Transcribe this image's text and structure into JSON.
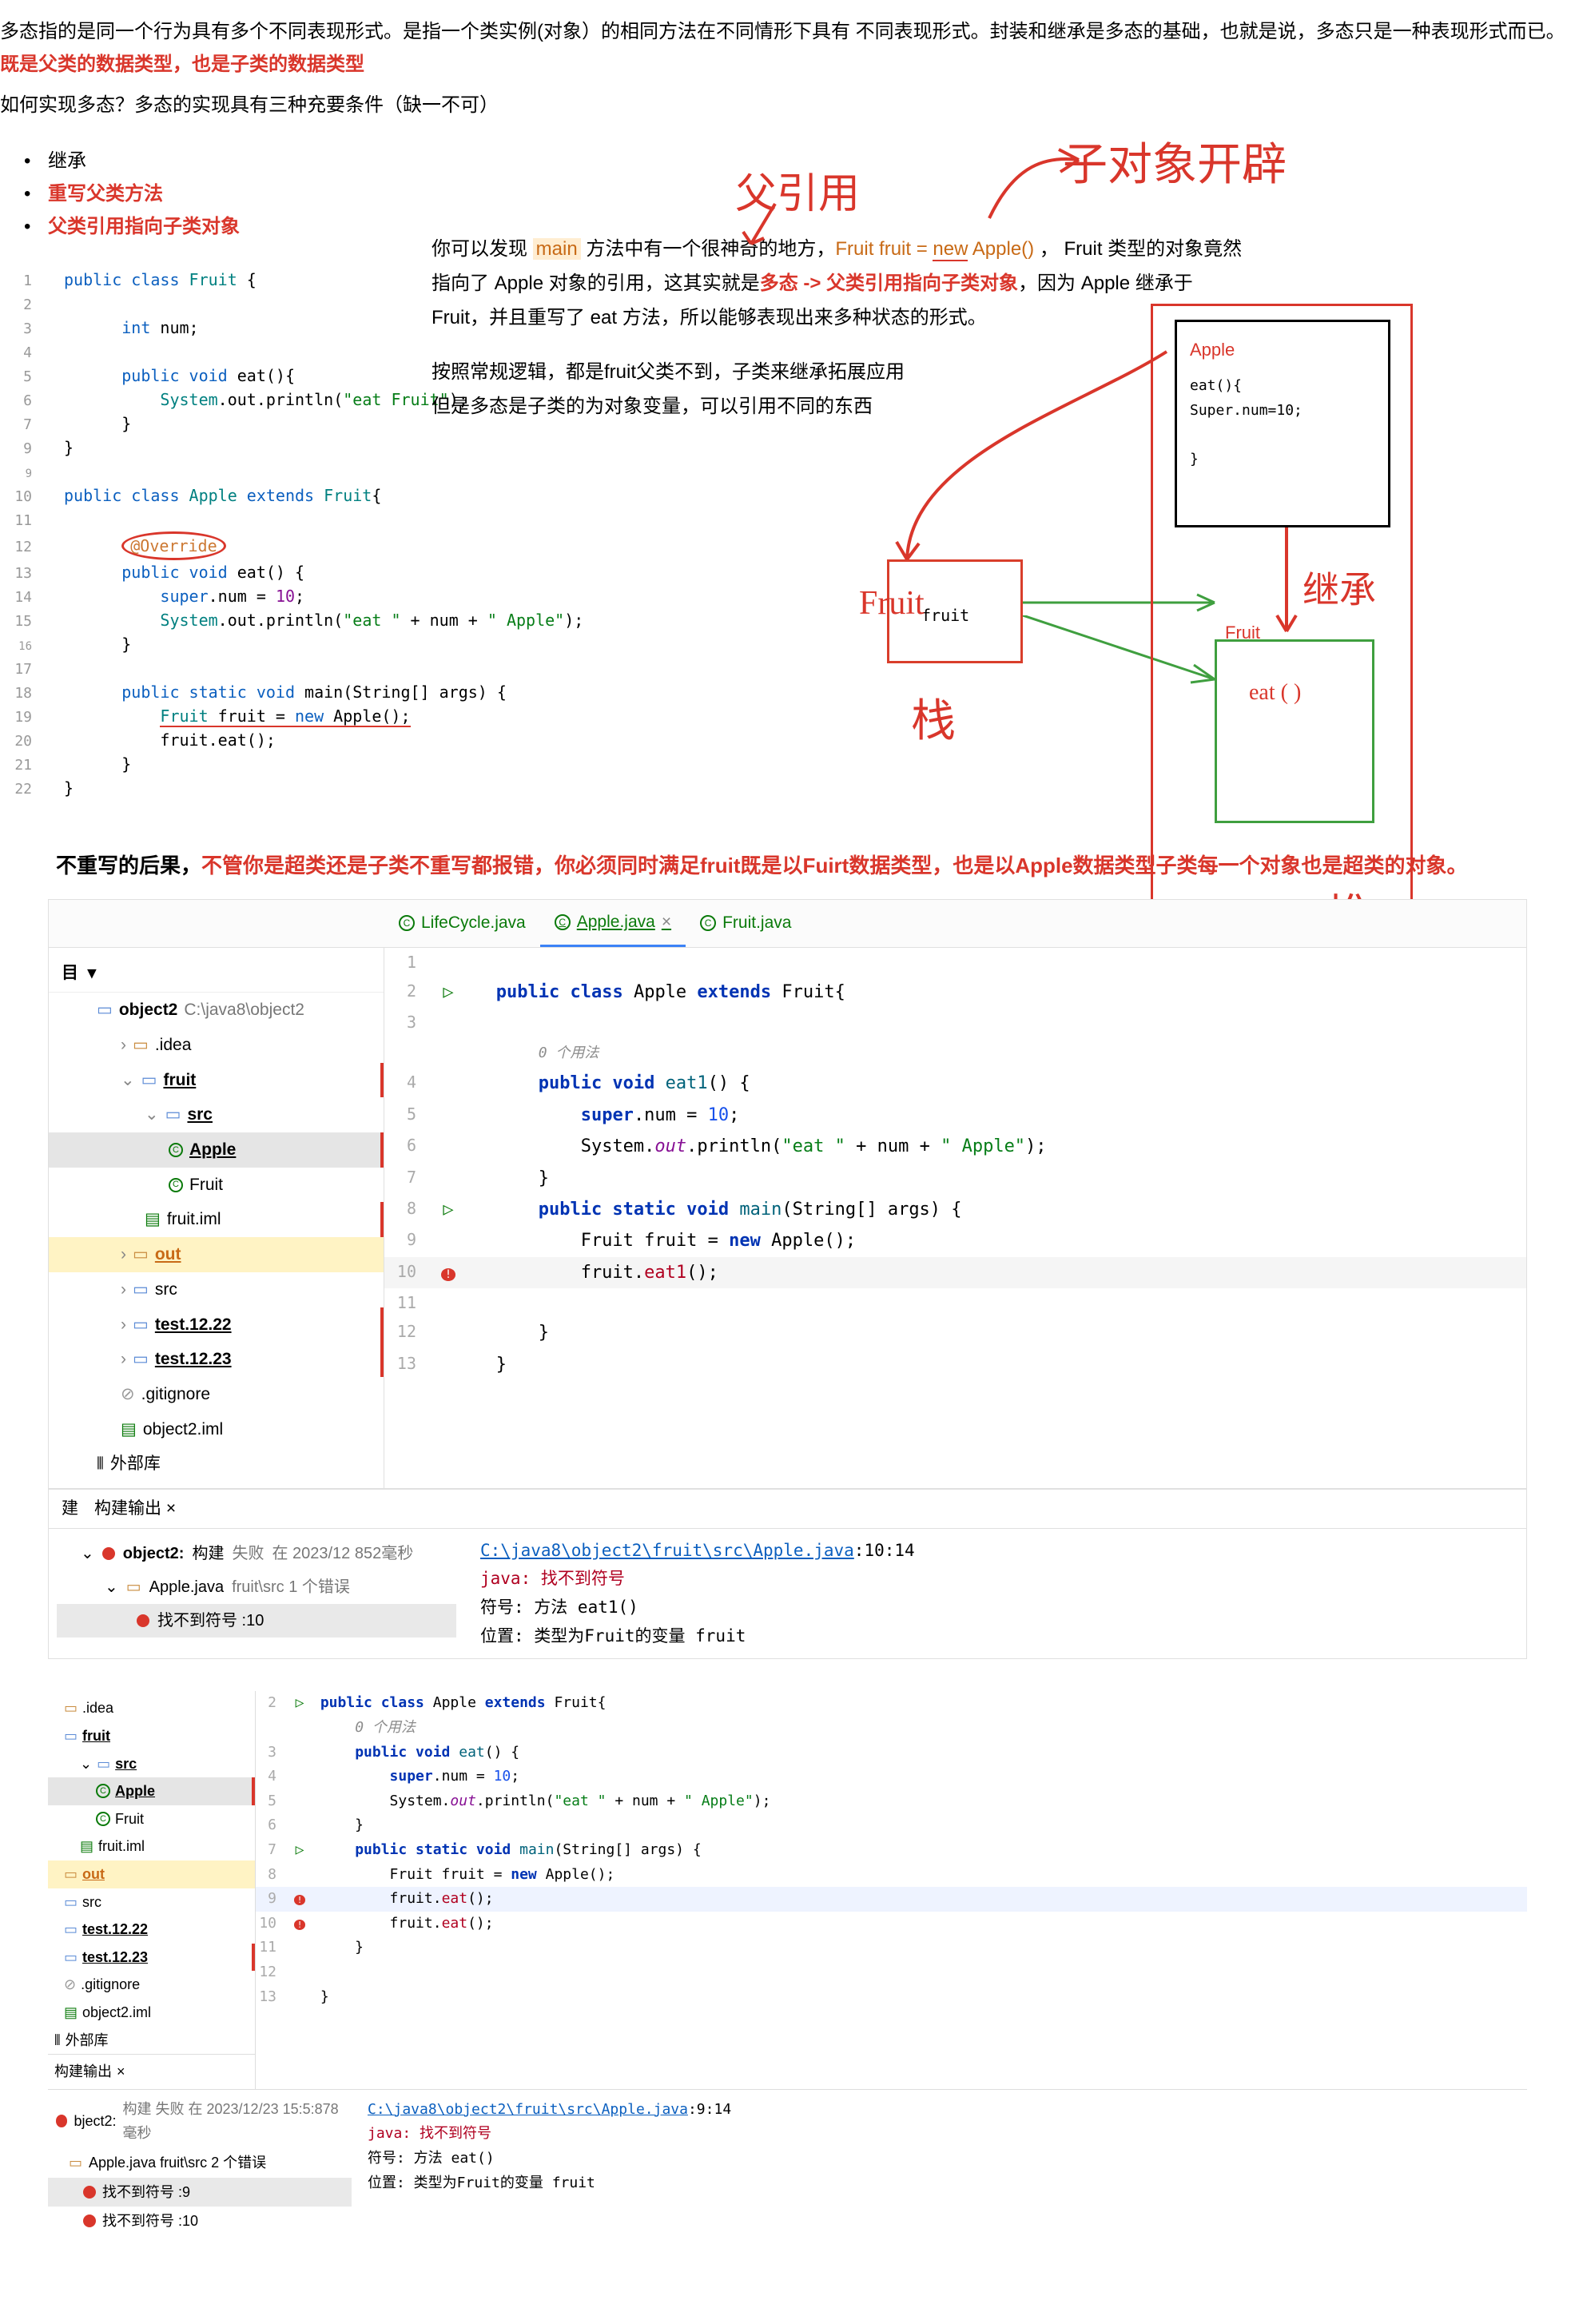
{
  "intro": {
    "line1": "多态指的是同一个行为具有多个不同表现形式。是指一个类实例(对象）的相同方法在不同情形下具有 不同表现形式。封装和继承是多态的基础，也就是说，多态只是一种表现形式而已。",
    "redSuffix": "既是父类的数据类型，也是子类的数据类型",
    "line2": "如何实现多态？多态的实现具有三种充要条件（缺一不可）",
    "b1": "继承",
    "b2": "重写父类方法",
    "b3": "父类引用指向子类对象"
  },
  "rightcol": {
    "l1a": "你可以发现 ",
    "l1b": "main",
    "l1c": " 方法中有一个很神奇的地方，",
    "l1d": "Fruit fruit = ",
    "l1e": "new",
    "l1f": " Apple()",
    "l1g": " ， Fruit 类型的对象竟然指向了 Apple 对象的引用，这其实就是",
    "l1h": "多态 -> 父类引用指向子类对象",
    "l1i": "，因为 Apple 继承于 Fruit，并且重写了 eat 方法，所以能够表现出来多种状态的形式。",
    "l2": "按照常规逻辑，都是fruit父类不到，子类来继承拓展应用",
    "l3": "但是多态是子类的为对象变量，可以引用不同的东西"
  },
  "code1": {
    "l1a": "public",
    "l1b": " class ",
    "l1c": "Fruit",
    "l1d": " {",
    "l3a": "int",
    "l3b": " num;",
    "l5a": "public",
    "l5b": " void ",
    "l5c": "eat",
    "l5d": "(){",
    "l6a": "System",
    "l6b": ".out.",
    "l6c": "println",
    "l6d": "(",
    "l6e": "\"eat Fruit\"",
    "l6f": ");",
    "l7": "}",
    "l9": "}",
    "l10a": "public",
    "l10b": " class ",
    "l10c": "Apple",
    "l10d": " extends ",
    "l10e": "Fruit",
    "l10f": "{",
    "l12": "@Override",
    "l13a": "public",
    "l13b": " void ",
    "l13c": "eat",
    "l13d": "() {",
    "l14a": "super",
    "l14b": ".num = ",
    "l14c": "10",
    "l14d": ";",
    "l15a": "System",
    "l15b": ".out.",
    "l15c": "println",
    "l15d": "(",
    "l15e": "\"eat \"",
    "l15f": " + num + ",
    "l15g": "\" Apple\"",
    "l15h": ");",
    "l16": "}",
    "l18a": "public",
    "l18b": " static ",
    "l18c": "void ",
    "l18d": "main",
    "l18e": "(String[] args) {",
    "l19a": "Fruit",
    "l19b": " fruit = ",
    "l19c": "new",
    "l19d": " Apple();",
    "l20": "fruit.eat();",
    "l21": "}",
    "l22": "}"
  },
  "section2": {
    "titleA": "不重写的后果，",
    "titleB": "不管你是超类还是子类不重写都报错，你必须同时满足fruit既是以Fuirt数据类型，也是以Apple数据类型子类每一个对象也是超类的对象。"
  },
  "ide": {
    "tabs": {
      "t1": "LifeCycle.java",
      "t2": "Apple.java",
      "t3": "Fruit.java"
    },
    "treeHead": "目",
    "tree": {
      "r0a": "object2",
      "r0b": " C:\\java8\\object2",
      "r1": ".idea",
      "r2": "fruit",
      "r3": "src",
      "r4": "Apple",
      "r5": "Fruit",
      "r6": "fruit.iml",
      "r7": "out",
      "r8": "src",
      "r9": "test.12.22",
      "r10": "test.12.23",
      "r11": ".gitignore",
      "r12": "object2.iml",
      "r13": "外部库"
    },
    "editor": {
      "l2": "public class Apple extends Fruit{",
      "comm": "0 个用法",
      "l4": "public void eat1() {",
      "l5a": "super",
      "l5b": ".num = ",
      "l5c": "10",
      "l5d": ";",
      "l6a": "System.",
      "l6b": "out",
      "l6c": ".println(",
      "l6d": "\"eat \"",
      "l6e": " + num + ",
      "l6f": "\" Apple\"",
      "l6g": ");",
      "l7": "}",
      "l8": "public static void main(String[] args) {",
      "l9": "Fruit fruit = new Apple();",
      "l10": "fruit.eat1();",
      "l11": "",
      "l12": "}",
      "l13": "}"
    }
  },
  "build": {
    "tab1": "建",
    "tab2": "构建输出",
    "row1a": "object2:",
    "row1b": " 构建 ",
    "row1c": "失败",
    "row1d": " 在 2023/12 852毫秒",
    "row2a": "Apple.java",
    "row2b": " fruit\\src 1 个错误",
    "row3": "找不到符号 :10",
    "link": "C:\\java8\\object2\\fruit\\src\\Apple.java",
    "linkLoc": ":10:14",
    "err1": "java: 找不到符号",
    "err2": "  符号:   方法 eat1()",
    "err3": "  位置: 类型为Fruit的变量 fruit"
  },
  "small": {
    "tree": {
      "idea": ".idea",
      "fruit": "fruit",
      "src": "src",
      "apple": "Apple",
      "Fruit": "Fruit",
      "iml": "fruit.iml",
      "out": "out",
      "src2": "src",
      "t1": "test.12.22",
      "t2": "test.12.23",
      "git": ".gitignore",
      "obj": "object2.iml",
      "lib": "外部库",
      "buildtab": "构建输出"
    },
    "ed": {
      "l2": "public class Apple extends Fruit{",
      "comm": "0 个用法",
      "l3": "public void eat() {",
      "l4": "super.num = 10;",
      "l5": "System.out.println(\"eat \" + num + \" Apple\");",
      "l6": "}",
      "l7": "public static void main(String[] args) {",
      "l8": "Fruit fruit = new Apple();",
      "l9": "fruit.eat();",
      "l10": "fruit.eat();",
      "l11": "}",
      "l13": "}"
    },
    "build": {
      "r1a": "bject2:",
      "r1b": " 构建 失败 在 2023/12/23 15:5:878毫秒",
      "r2": "Apple.java fruit\\src 2 个错误",
      "r3": "找不到符号 :9",
      "r4": "找不到符号 :10",
      "link": "C:\\java8\\object2\\fruit\\src\\Apple.java",
      "linkLoc": ":9:14",
      "e1": "java: 找不到符号",
      "e2": "  符号:   方法 eat()",
      "e3": "  位置: 类型为Fruit的变量 fruit"
    }
  },
  "diagram": {
    "apple": "Apple",
    "appleBody1": "eat(){",
    "appleBody2": "Super.num=10;",
    "appleBody3": "}",
    "fruitVar": "fruit",
    "fruitLbl": "Fruit",
    "eat": "eat ( )"
  },
  "hand": {
    "h1": "父引用",
    "h2": "子对象开辟",
    "h3": "Fruit",
    "h4": "栈",
    "h5": "继承",
    "h6": "堆"
  }
}
